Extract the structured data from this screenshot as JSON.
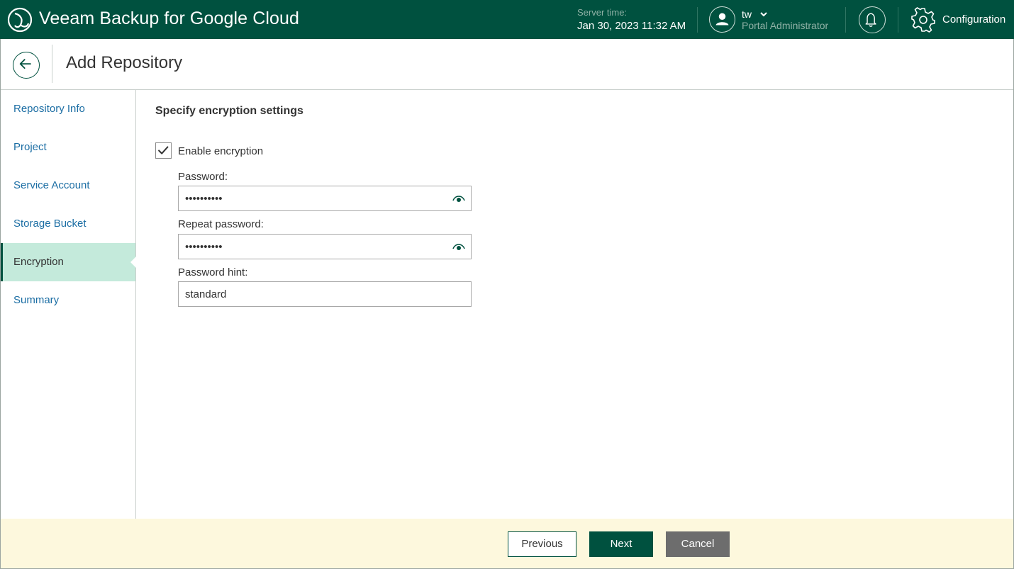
{
  "header": {
    "app_title": "Veeam Backup for Google Cloud",
    "server_time_label": "Server time:",
    "server_time_value": "Jan 30, 2023 11:32 AM",
    "user_name": "tw",
    "user_role": "Portal Administrator",
    "configuration_label": "Configuration"
  },
  "page": {
    "title": "Add Repository"
  },
  "sidebar": {
    "items": [
      {
        "label": "Repository Info",
        "active": false
      },
      {
        "label": "Project",
        "active": false
      },
      {
        "label": "Service Account",
        "active": false
      },
      {
        "label": "Storage Bucket",
        "active": false
      },
      {
        "label": "Encryption",
        "active": true
      },
      {
        "label": "Summary",
        "active": false
      }
    ]
  },
  "main": {
    "section_title": "Specify encryption settings",
    "enable_encryption": {
      "label": "Enable encryption",
      "checked": true
    },
    "password": {
      "label": "Password:",
      "value": "••••••••••"
    },
    "repeat_password": {
      "label": "Repeat password:",
      "value": "••••••••••"
    },
    "password_hint": {
      "label": "Password hint:",
      "value": "standard"
    }
  },
  "footer": {
    "previous_label": "Previous",
    "next_label": "Next",
    "cancel_label": "Cancel"
  },
  "colors": {
    "brand_green": "#00513f",
    "active_item_bg": "#c4eadb",
    "link_blue": "#1c6ea4",
    "footer_bg": "#fdf8dd",
    "cancel_gray": "#6d6d6d"
  }
}
